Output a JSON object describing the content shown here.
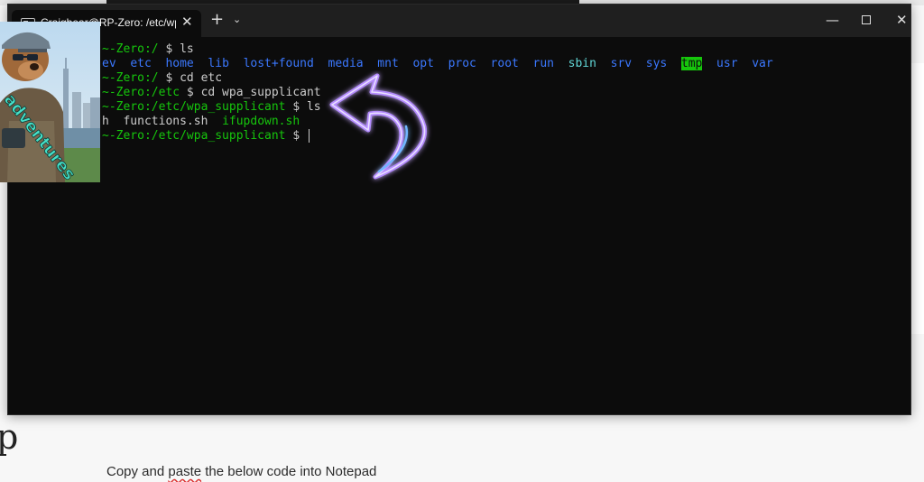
{
  "window": {
    "tab_title": "Craigbear@RP-Zero: /etc/wpa",
    "icons": {
      "tab": "terminal-icon",
      "close": "close-icon",
      "new_tab": "plus-icon",
      "dropdown": "chevron-down-icon",
      "minimize": "minimize-icon",
      "maximize": "maximize-icon",
      "window_close": "close-icon"
    }
  },
  "terminal": {
    "lines": [
      {
        "prompt": "~-Zero:/",
        "cmd": " $ ls"
      },
      {
        "ls1": [
          "ev",
          "etc",
          "home",
          "lib",
          "lost+found",
          "media",
          "mnt",
          "opt",
          "proc",
          "root",
          "run",
          "sbin",
          "srv",
          "sys",
          "tmp",
          "usr",
          "var"
        ]
      },
      {
        "prompt": "~-Zero:/",
        "cmd": " $ cd etc"
      },
      {
        "prompt": "~-Zero:/etc",
        "cmd": " $ cd wpa_supplicant"
      },
      {
        "prompt": "~-Zero:/etc/wpa_supplicant",
        "cmd": " $ ls"
      },
      {
        "ls2": [
          "h",
          "functions.sh",
          "ifupdown.sh"
        ]
      },
      {
        "prompt": "~-Zero:/etc/wpa_supplicant",
        "cmd": " $ "
      }
    ],
    "colors": {
      "directory": "#3b78ff",
      "executable": "#16c60c",
      "highlight_bg": "#16c60c",
      "background": "#0c0c0c"
    }
  },
  "sticker": {
    "text": "adventures",
    "icon": "bear-icon"
  },
  "arrow": {
    "icon": "curved-arrow-icon"
  },
  "background_doc": {
    "big_letter": "p",
    "instruction_prefix": "Copy and ",
    "instruction_squiggle": "paste",
    "instruction_suffix": " the below code into Notepad"
  }
}
